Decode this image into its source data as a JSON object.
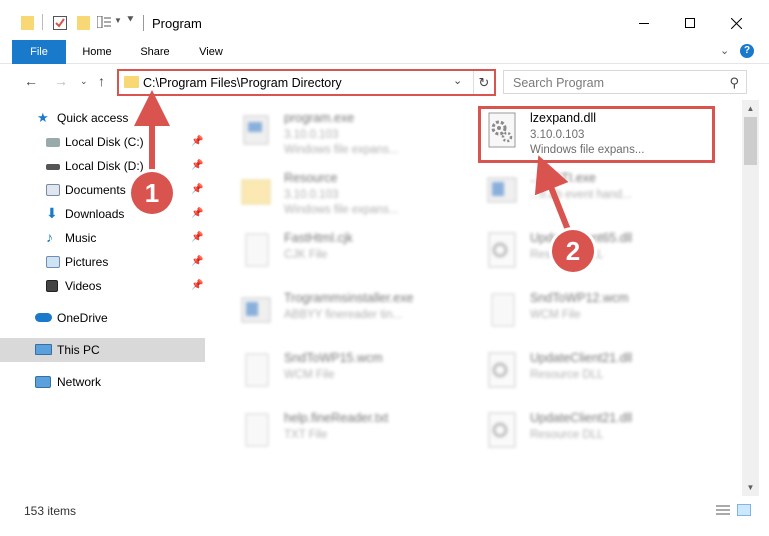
{
  "window": {
    "title": "Program"
  },
  "ribbon": {
    "tabs": [
      "File",
      "Home",
      "Share",
      "View"
    ]
  },
  "address": {
    "path": "C:\\Program Files\\Program Directory",
    "search_placeholder": "Search Program"
  },
  "sidebar": {
    "items": [
      {
        "label": "Quick access",
        "icon": "star-icon"
      },
      {
        "label": "Local Disk (C:)",
        "icon": "drive-icon"
      },
      {
        "label": "Local Disk (D:)",
        "icon": "drive-icon"
      },
      {
        "label": "Documents",
        "icon": "documents-icon"
      },
      {
        "label": "Downloads",
        "icon": "downloads-icon"
      },
      {
        "label": "Music",
        "icon": "music-icon"
      },
      {
        "label": "Pictures",
        "icon": "pictures-icon"
      },
      {
        "label": "Videos",
        "icon": "videos-icon"
      },
      {
        "label": "OneDrive",
        "icon": "cloud-icon"
      },
      {
        "label": "This PC",
        "icon": "computer-icon"
      },
      {
        "label": "Network",
        "icon": "network-icon"
      }
    ]
  },
  "files": {
    "highlighted": {
      "name": "lzexpand.dll",
      "version": "3.10.0.103",
      "type": "Windows file expans..."
    },
    "left": [
      {
        "name": "program.exe",
        "line1": "3.10.0.103",
        "line2": "Windows file expans..."
      },
      {
        "name": "Resource",
        "line1": "3.10.0.103",
        "line2": "Windows file expans..."
      },
      {
        "name": "FastHtml.cjk",
        "line1": "CJK File",
        "line2": ""
      },
      {
        "name": "Trogrammsinstaller.exe",
        "line1": "ABBYY finereader tin...",
        "line2": ""
      },
      {
        "name": "SndToWP15.wcm",
        "line1": "WCM File",
        "line2": ""
      },
      {
        "name": "help.fineReader.txt",
        "line1": "TXT File",
        "line2": ""
      }
    ],
    "right": [
      {
        "name": "...ysSTI.exe",
        "line1": "...II.ab event hand...",
        "line2": ""
      },
      {
        "name": "UpdateClient65.dll",
        "line1": "Resource DLL",
        "line2": ""
      },
      {
        "name": "SndToWP12.wcm",
        "line1": "WCM File",
        "line2": ""
      },
      {
        "name": "UpdateClient21.dll",
        "line1": "Resource DLL",
        "line2": ""
      },
      {
        "name": "UpdateClient21.dll",
        "line1": "Resource DLL",
        "line2": ""
      }
    ]
  },
  "status": {
    "item_count": "153 items"
  },
  "annotations": {
    "callout1": "1",
    "callout2": "2"
  },
  "colors": {
    "accent": "#1979ca",
    "highlight": "#d9534f"
  }
}
